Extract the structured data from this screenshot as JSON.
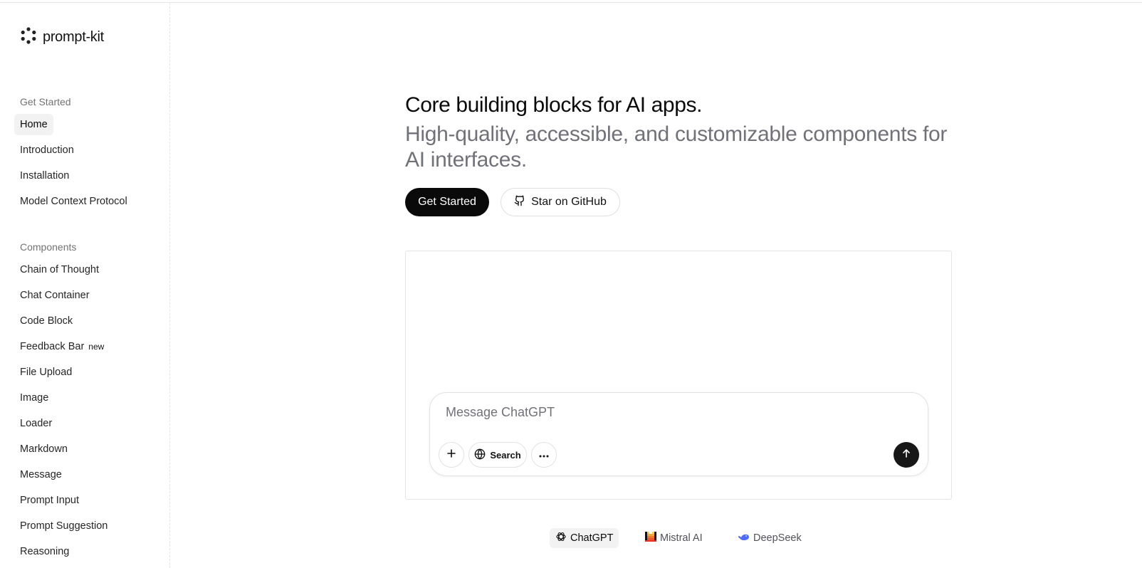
{
  "brand": {
    "name": "prompt-kit",
    "logo_icon": "dotted-ring-logo-icon"
  },
  "sidebar": {
    "sections": [
      {
        "label": "Get Started",
        "items": [
          {
            "label": "Home",
            "active": true
          },
          {
            "label": "Introduction"
          },
          {
            "label": "Installation"
          },
          {
            "label": "Model Context Protocol"
          }
        ]
      },
      {
        "label": "Components",
        "items": [
          {
            "label": "Chain of Thought"
          },
          {
            "label": "Chat Container"
          },
          {
            "label": "Code Block"
          },
          {
            "label": "Feedback Bar",
            "badge": "new"
          },
          {
            "label": "File Upload"
          },
          {
            "label": "Image"
          },
          {
            "label": "Loader"
          },
          {
            "label": "Markdown"
          },
          {
            "label": "Message"
          },
          {
            "label": "Prompt Input"
          },
          {
            "label": "Prompt Suggestion"
          },
          {
            "label": "Reasoning"
          }
        ]
      }
    ]
  },
  "hero": {
    "title": "Core building blocks for AI apps.",
    "subtitle": "High-quality, accessible, and customizable components for AI interfaces.",
    "primary_button": "Get Started",
    "secondary_button": "Star on GitHub",
    "secondary_icon": "github-icon"
  },
  "demo": {
    "input_placeholder": "Message ChatGPT",
    "input_value": "",
    "add_icon": "plus-icon",
    "search_label": "Search",
    "search_icon": "globe-icon",
    "more_icon": "ellipsis-icon",
    "send_icon": "arrow-up-icon"
  },
  "model_tabs": [
    {
      "label": "ChatGPT",
      "icon": "openai-icon",
      "active": true
    },
    {
      "label": "Mistral AI",
      "icon": "mistral-icon"
    },
    {
      "label": "DeepSeek",
      "icon": "deepseek-icon"
    }
  ],
  "colors": {
    "primary": "#0a0a0a",
    "muted_text": "#71717a",
    "border": "#e5e5e5",
    "active_bg": "#f2f2f2",
    "deepseek_blue": "#4d6bfe"
  }
}
